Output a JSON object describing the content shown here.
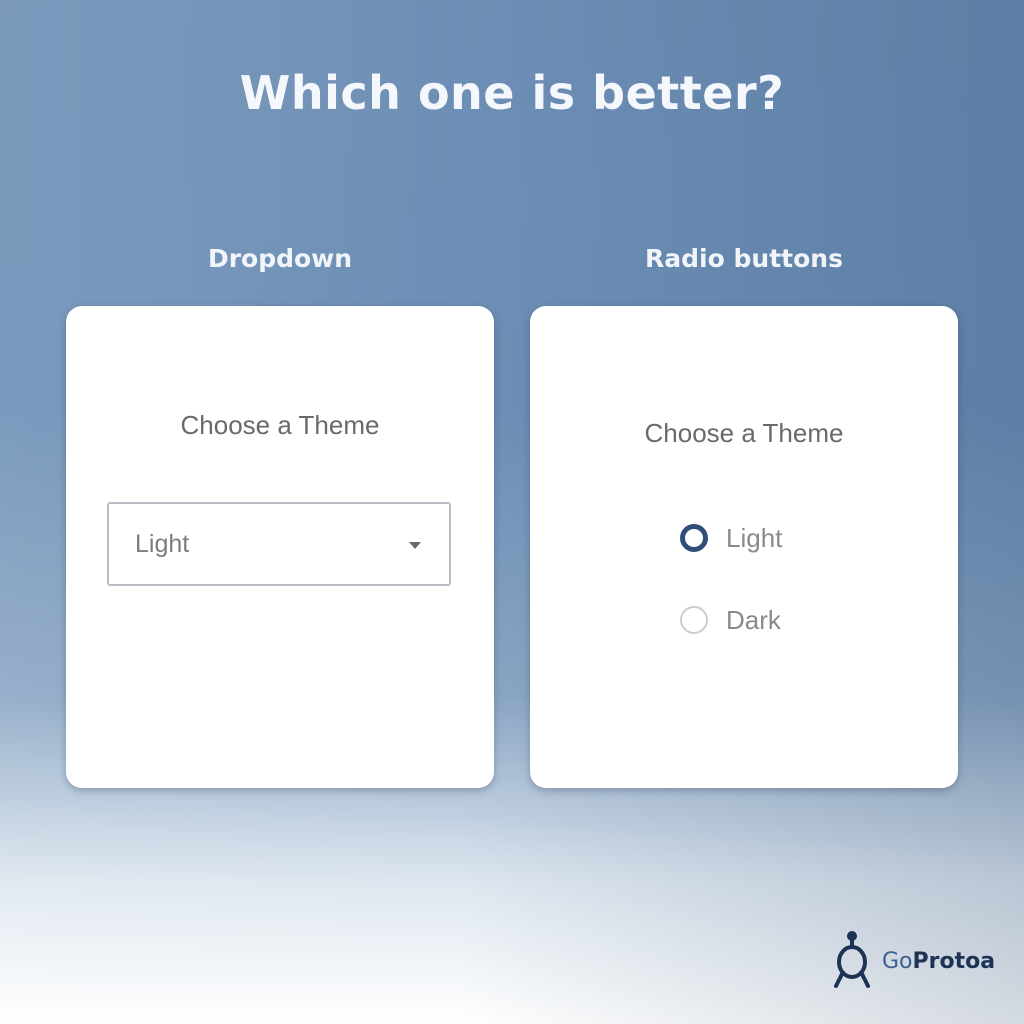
{
  "headline": "Which one is better?",
  "dropdown_panel": {
    "column_label": "Dropdown",
    "heading": "Choose a Theme",
    "select": {
      "selected_value": "Light",
      "caret_icon": "chevron-down-icon"
    }
  },
  "radio_panel": {
    "column_label": "Radio buttons",
    "heading": "Choose a Theme",
    "options": [
      {
        "label": "Light",
        "checked": true
      },
      {
        "label": "Dark",
        "checked": false
      }
    ]
  },
  "logo": {
    "prefix": "Go",
    "name": "Protoa",
    "icon": "goprotoa-logo-icon",
    "color": "#1d3356"
  },
  "colors": {
    "background_top": "#6e8fb5",
    "background_bottom": "#ffffff",
    "card": "#ffffff",
    "radio_checked": "#2f4f7a",
    "radio_unchecked": "#c9cdd3"
  }
}
